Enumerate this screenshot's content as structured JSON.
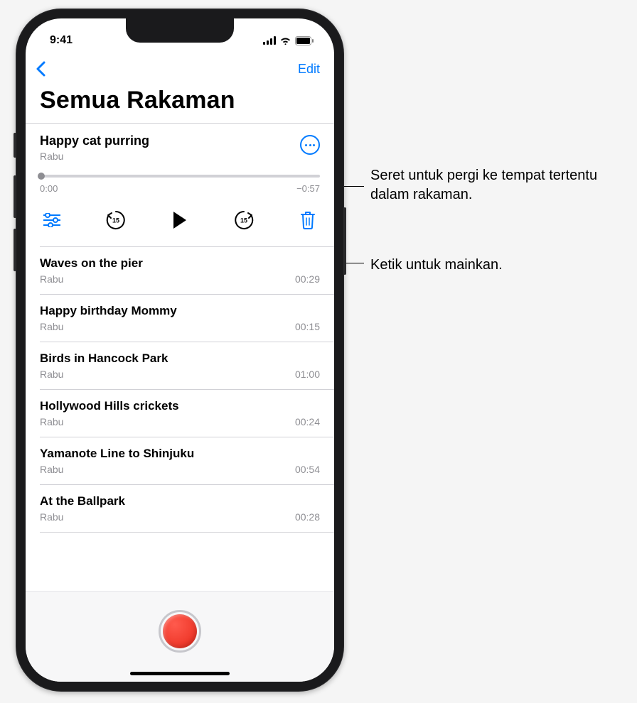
{
  "status": {
    "time": "9:41"
  },
  "nav": {
    "edit_label": "Edit"
  },
  "page_title": "Semua Rakaman",
  "expanded": {
    "title": "Happy cat purring",
    "subtitle": "Rabu",
    "time_elapsed": "0:00",
    "time_remaining": "−0:57",
    "skip_back_seconds": "15",
    "skip_forward_seconds": "15"
  },
  "recordings": [
    {
      "title": "Waves on the pier",
      "subtitle": "Rabu",
      "duration": "00:29"
    },
    {
      "title": "Happy birthday Mommy",
      "subtitle": "Rabu",
      "duration": "00:15"
    },
    {
      "title": "Birds in Hancock Park",
      "subtitle": "Rabu",
      "duration": "01:00"
    },
    {
      "title": "Hollywood Hills crickets",
      "subtitle": "Rabu",
      "duration": "00:24"
    },
    {
      "title": "Yamanote Line to Shinjuku",
      "subtitle": "Rabu",
      "duration": "00:54"
    },
    {
      "title": "At the Ballpark",
      "subtitle": "Rabu",
      "duration": "00:28"
    }
  ],
  "callouts": {
    "scrubber": "Seret untuk pergi ke tempat tertentu dalam rakaman.",
    "play": "Ketik untuk mainkan."
  }
}
